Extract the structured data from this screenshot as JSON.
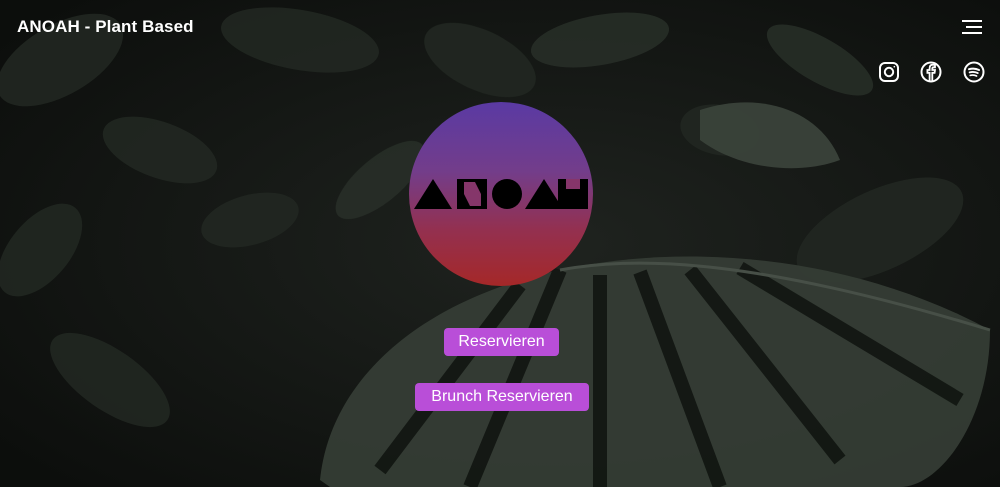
{
  "header": {
    "site_title": "ANOAH - Plant Based"
  },
  "icons": {
    "menu": "hamburger-menu-icon",
    "social": [
      "instagram-icon",
      "facebook-icon",
      "spotify-icon"
    ]
  },
  "hero": {
    "logo_text": "ANOAH",
    "buttons": {
      "reserve_label": "Reservieren",
      "brunch_label": "Brunch Reservieren"
    }
  },
  "colors": {
    "button_bg": "#b94ed8",
    "logo_gradient_top": "#5a3aa3",
    "logo_gradient_bottom": "#a52828",
    "text": "#ffffff"
  }
}
